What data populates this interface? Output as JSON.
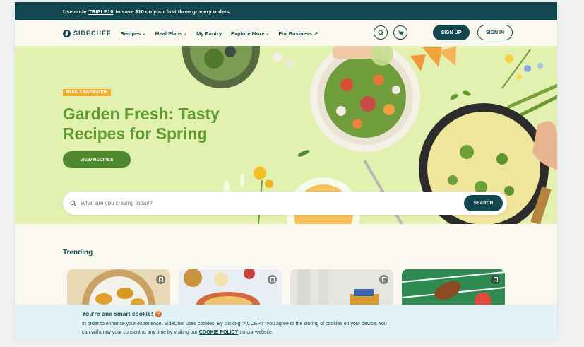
{
  "promo": {
    "prefix": "Use code",
    "code": "TRIPLE10",
    "suffix": "to save $10 on your first three grocery orders."
  },
  "nav": {
    "logo": "SIDECHEF",
    "items": [
      {
        "label": "Recipes",
        "dropdown": true
      },
      {
        "label": "Meal Plans",
        "dropdown": true
      },
      {
        "label": "My Pantry",
        "dropdown": false
      },
      {
        "label": "Explore More",
        "dropdown": true
      },
      {
        "label": "For Business ↗",
        "dropdown": false
      }
    ],
    "signup": "SIGN UP",
    "signin": "SIGN IN"
  },
  "hero": {
    "badge": "WEEKLY INSPIRATION",
    "title": "Garden Fresh: Tasty Recipes for Spring",
    "cta": "VIEW RECIPES"
  },
  "search": {
    "placeholder": "What are you craving today?",
    "button": "SEARCH"
  },
  "trending": {
    "title": "Trending"
  },
  "cookie": {
    "title": "You're one smart cookie! 🍪",
    "text_1": "In order to enhance your experience, SideChef uses cookies. By clicking \"ACCEPT\" you agree to the storing of cookies on your device. You",
    "text_2_prefix": "can withdraw your consent at any time by visiting our",
    "link": "COOKIE POLICY",
    "text_2_suffix": "on our website."
  },
  "colors": {
    "brand": "#12474f",
    "hero_bg": "#e3f1b0",
    "hero_title": "#5e9a2f",
    "cta": "#4e8a2d",
    "badge": "#f6ad2d"
  },
  "icons": [
    "search-icon",
    "cart-icon",
    "bookmark-icon"
  ]
}
